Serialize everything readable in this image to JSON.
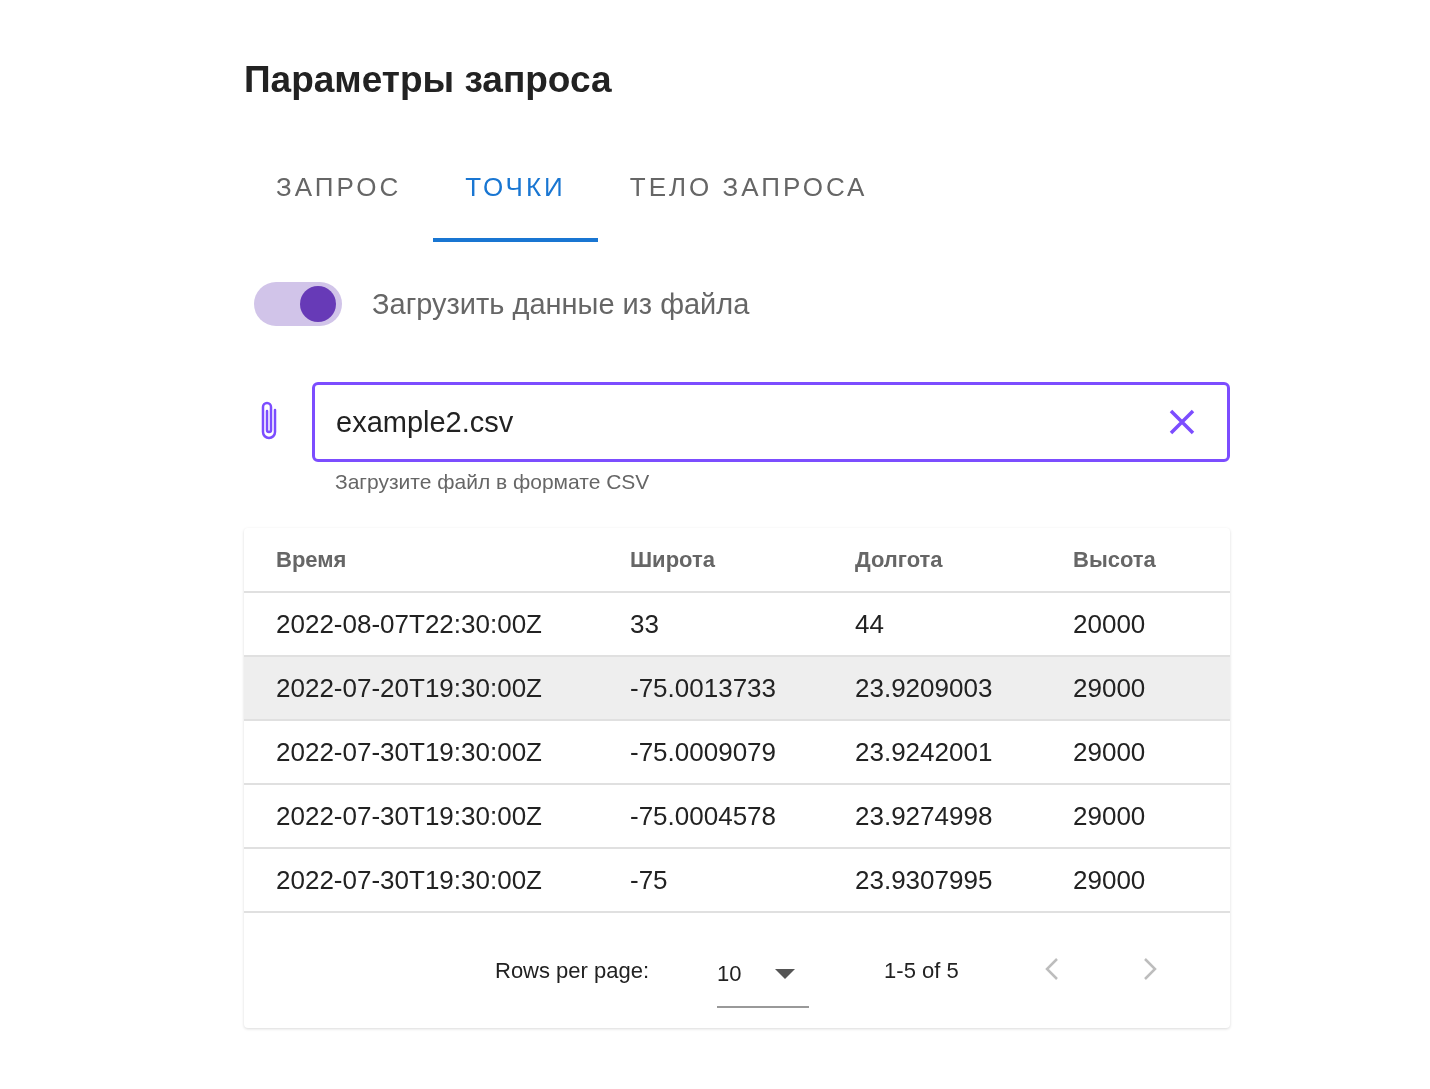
{
  "title": "Параметры запроса",
  "tabs": [
    {
      "label": "ЗАПРОС",
      "selected": false
    },
    {
      "label": "ТОЧКИ",
      "selected": true
    },
    {
      "label": "ТЕЛО ЗАПРОСА",
      "selected": false
    }
  ],
  "file_toggle": {
    "label": "Загрузить данные из файла",
    "on": true
  },
  "file_field": {
    "value": "example2.csv",
    "hint": "Загрузите файл в формате CSV"
  },
  "table": {
    "columns": [
      "Время",
      "Широта",
      "Долгота",
      "Высота"
    ],
    "rows": [
      {
        "cells": [
          "2022-08-07T22:30:00Z",
          "33",
          "44",
          "20000"
        ],
        "selected": false
      },
      {
        "cells": [
          "2022-07-20T19:30:00Z",
          "-75.0013733",
          "23.9209003",
          "29000"
        ],
        "selected": true
      },
      {
        "cells": [
          "2022-07-30T19:30:00Z",
          "-75.0009079",
          "23.9242001",
          "29000"
        ],
        "selected": false
      },
      {
        "cells": [
          "2022-07-30T19:30:00Z",
          "-75.0004578",
          "23.9274998",
          "29000"
        ],
        "selected": false
      },
      {
        "cells": [
          "2022-07-30T19:30:00Z",
          "-75",
          "23.9307995",
          "29000"
        ],
        "selected": false
      }
    ]
  },
  "pagination": {
    "rows_per_page_label": "Rows per page:",
    "rows_per_page": "10",
    "range": "1-5 of 5",
    "prev_disabled": true,
    "next_disabled": true
  }
}
